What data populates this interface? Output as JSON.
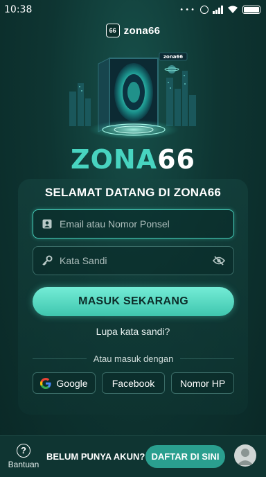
{
  "status_bar": {
    "time": "10:38",
    "dots": "•••"
  },
  "brand": {
    "badge": "66",
    "name": "zona66"
  },
  "hero": {
    "door_badge": "zona66"
  },
  "logo": {
    "part1": "ZONA",
    "part2": "66"
  },
  "login": {
    "title": "SELAMAT DATANG DI ZONA66",
    "email_placeholder": "Email atau Nomor Ponsel",
    "password_placeholder": "Kata Sandi",
    "submit_label": "MASUK SEKARANG",
    "forgot_label": "Lupa kata sandi?",
    "divider_label": "Atau masuk dengan",
    "social": [
      {
        "label": "Google",
        "icon": "google-icon"
      },
      {
        "label": "Facebook"
      },
      {
        "label": "Nomor HP"
      }
    ]
  },
  "footer": {
    "help_label": "Bantuan",
    "help_icon": "?",
    "no_account_label": "BELUM PUNYA AKUN?",
    "register_label": "DAFTAR DI SINI"
  },
  "colors": {
    "accent": "#48d4c0",
    "button": "#5ad8c2",
    "register": "#2a9f8f",
    "background": "#0e3532"
  }
}
